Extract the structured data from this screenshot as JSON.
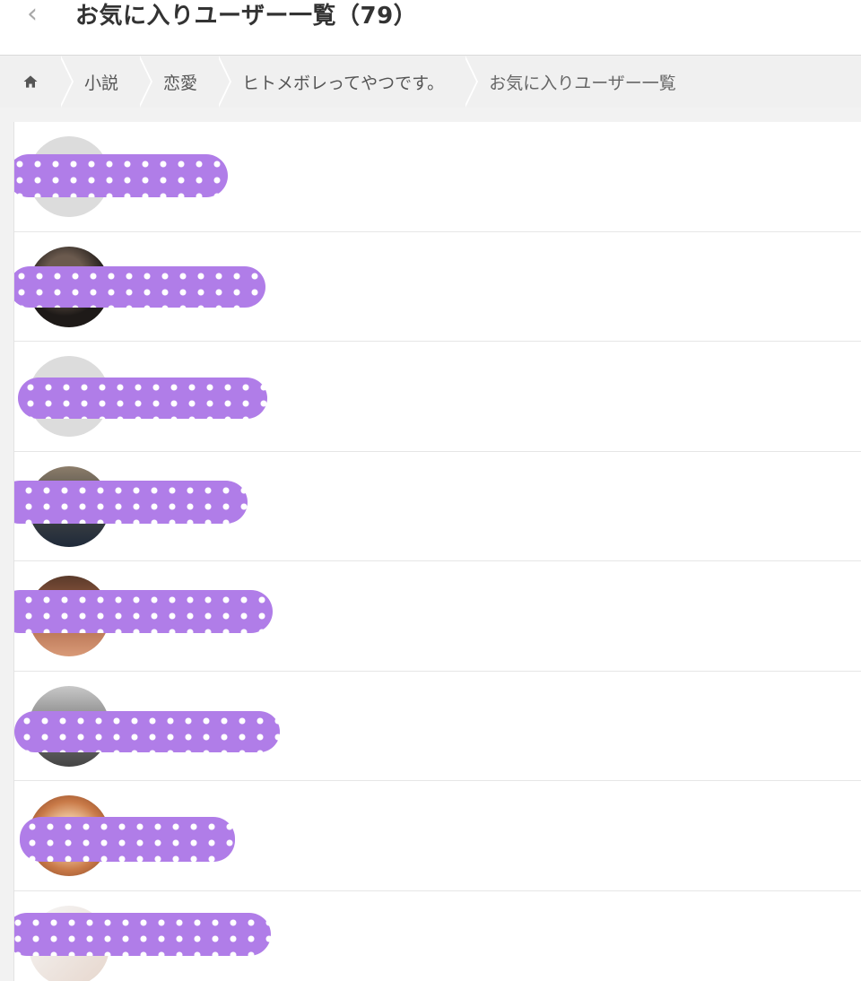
{
  "header": {
    "back_icon": "chevron-left-icon",
    "back_glyph": "‹",
    "title": "お気に入りユーザー一覧（79）"
  },
  "breadcrumb": {
    "home_icon": "home-icon",
    "items": [
      "小説",
      "恋愛",
      "ヒトメボレってやつです。",
      "お気に入りユーザー一覧"
    ]
  },
  "colors": {
    "redaction": "#b07de8",
    "redaction_dots": "#ffffff",
    "header_bg": "#ffffff",
    "breadcrumb_bg": "#f0f0f0"
  },
  "users": [
    {
      "avatar": "default-avatar",
      "name_redacted": true
    },
    {
      "avatar": "photo-avatar",
      "name_redacted": true
    },
    {
      "avatar": "default-avatar",
      "name_redacted": true
    },
    {
      "avatar": "photo-avatar",
      "name_redacted": true
    },
    {
      "avatar": "photo-avatar",
      "name_redacted": true
    },
    {
      "avatar": "photo-avatar",
      "name_redacted": true
    },
    {
      "avatar": "photo-avatar",
      "name_redacted": true
    },
    {
      "avatar": "photo-avatar",
      "name_redacted": true
    }
  ]
}
